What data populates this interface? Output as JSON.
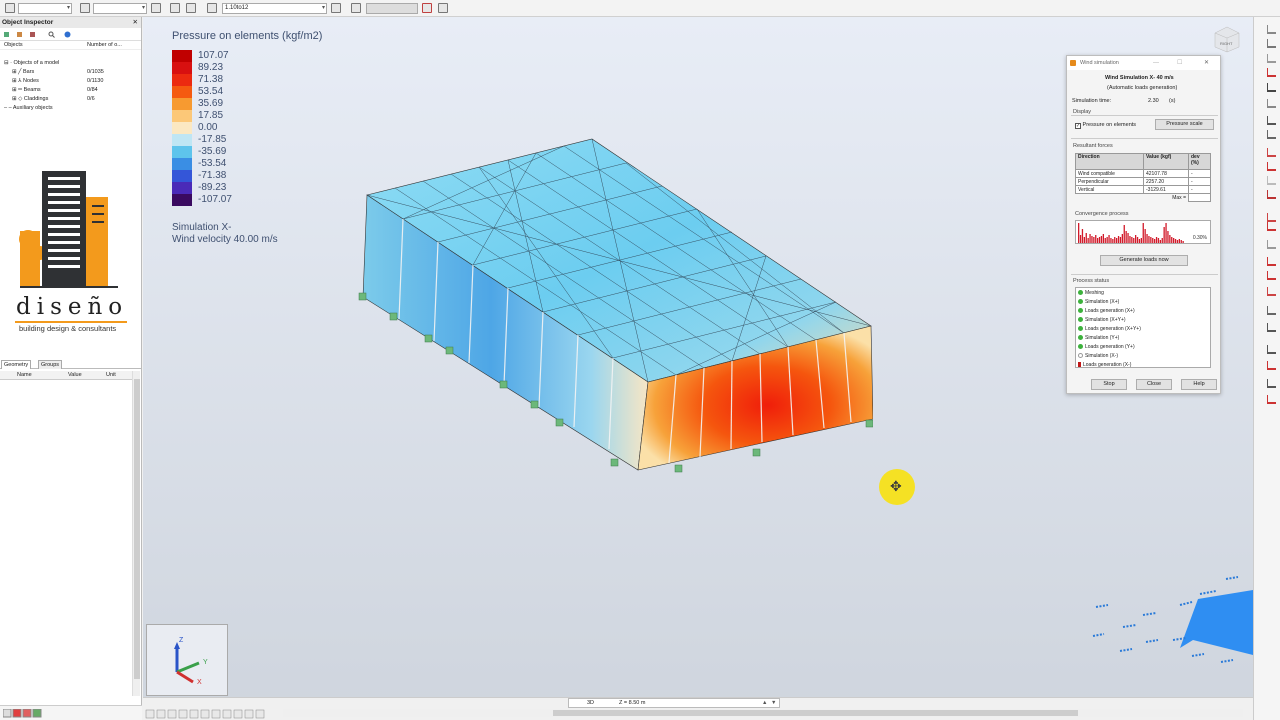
{
  "toolbar": {
    "select1": "",
    "select2": "",
    "select3": "1.10to12"
  },
  "inspector": {
    "title": "Object Inspector",
    "close": "✕",
    "col_objects": "Objects",
    "col_number": "Number of o...",
    "tree": [
      {
        "label": "Objects of a model",
        "count": ""
      },
      {
        "label": "Bars",
        "count": "0/1035"
      },
      {
        "label": "Nodes",
        "count": "0/1130"
      },
      {
        "label": "Beams",
        "count": "0/84"
      },
      {
        "label": "Claddings",
        "count": "0/6"
      },
      {
        "label": "Auxiliary objects",
        "count": ""
      }
    ],
    "tabs": [
      "Geometry",
      "Groups"
    ],
    "props_cols": [
      "Name",
      "Value",
      "Unit"
    ]
  },
  "logo": {
    "brand": "diseño",
    "tagline": "building design & consultants",
    "colors": {
      "orange": "#f39a1c",
      "dark": "#2f3134"
    }
  },
  "legend": {
    "title": "Pressure on elements (kgf/m2)",
    "entries": [
      {
        "value": "107.07",
        "color": "#c00000"
      },
      {
        "value": "89.23",
        "color": "#d81010"
      },
      {
        "value": "71.38",
        "color": "#ec2a10"
      },
      {
        "value": "53.54",
        "color": "#f55a10"
      },
      {
        "value": "35.69",
        "color": "#f79a30"
      },
      {
        "value": "17.85",
        "color": "#fcc878"
      },
      {
        "value": "0.00",
        "color": "#fbe8c2"
      },
      {
        "value": "-17.85",
        "color": "#bfe6f4"
      },
      {
        "value": "-35.69",
        "color": "#5ec4ec"
      },
      {
        "value": "-53.54",
        "color": "#3a8ee4"
      },
      {
        "value": "-71.38",
        "color": "#3456d8"
      },
      {
        "value": "-89.23",
        "color": "#4a2ab8"
      },
      {
        "value": "-107.07",
        "color": "#3a0a60"
      }
    ],
    "simulation": "Simulation X-",
    "velocity": "Wind velocity 40.00 m/s"
  },
  "view_cube": {
    "label": "RIGHT"
  },
  "axes": {
    "z": "Z",
    "y": "Y",
    "x": "X"
  },
  "status": {
    "view": "3D",
    "level": "Z = 8.50 m"
  },
  "dialog": {
    "window_title": "Wind simulation",
    "heading": "Wind Simulation X- 40 m/s",
    "subheading": "(Automatic loads generation)",
    "time_label": "Simulation time:",
    "time_value": "2.30",
    "time_unit": "(s)",
    "display_label": "Display",
    "pressure_checkbox": "Pressure on elements",
    "pressure_scale_btn": "Pressure scale",
    "resultant_label": "Resultant forces",
    "forces_headers": [
      "Direction",
      "Value (kgf)",
      "dev (%)"
    ],
    "forces_rows": [
      [
        "Wind compatible",
        "42107.78",
        "-"
      ],
      [
        "Perpendicular",
        "2257.20",
        "-"
      ],
      [
        "Vertical",
        "-3129.61",
        "-"
      ],
      [
        "",
        "Max =",
        ""
      ]
    ],
    "convergence_label": "Convergence process",
    "convergence_value": "0.30%",
    "generate_btn": "Generate loads now",
    "process_label": "Process status",
    "process_steps": [
      {
        "label": "Meshing",
        "state": "done"
      },
      {
        "label": "Simulation (X+)",
        "state": "done"
      },
      {
        "label": "Loads generation (X+)",
        "state": "done"
      },
      {
        "label": "Simulation (X+Y+)",
        "state": "done"
      },
      {
        "label": "Loads generation (X+Y+)",
        "state": "done"
      },
      {
        "label": "Simulation (Y+)",
        "state": "done"
      },
      {
        "label": "Loads generation (Y+)",
        "state": "done"
      },
      {
        "label": "Simulation (X-)",
        "state": "pending"
      },
      {
        "label": "Loads generation (X-)",
        "state": "active"
      }
    ],
    "stop_btn": "Stop",
    "close_btn": "Close",
    "help_btn": "Help"
  }
}
